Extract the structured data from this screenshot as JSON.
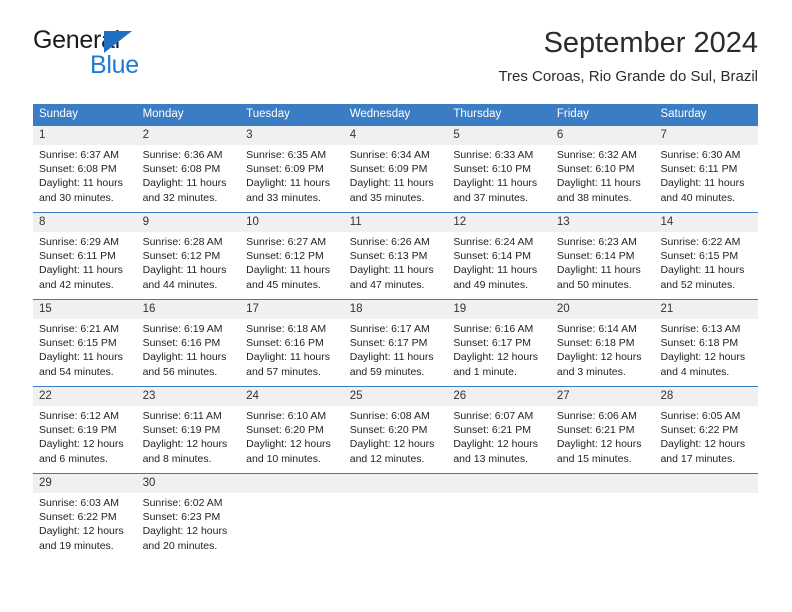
{
  "brand": {
    "line1": "General",
    "line2": "Blue",
    "triangle_color": "#1f6fc4",
    "blue_color": "#1f7ad4"
  },
  "header": {
    "title": "September 2024",
    "subtitle": "Tres Coroas, Rio Grande do Sul, Brazil"
  },
  "theme": {
    "header_blue": "#3b7dc4",
    "daynum_band": "#f0f0f0",
    "text": "#232323"
  },
  "weekdays": [
    "Sunday",
    "Monday",
    "Tuesday",
    "Wednesday",
    "Thursday",
    "Friday",
    "Saturday"
  ],
  "weeks": [
    {
      "numbers": [
        "1",
        "2",
        "3",
        "4",
        "5",
        "6",
        "7"
      ],
      "cells": [
        {
          "l1": "Sunrise: 6:37 AM",
          "l2": "Sunset: 6:08 PM",
          "l3": "Daylight: 11 hours",
          "l4": "and 30 minutes."
        },
        {
          "l1": "Sunrise: 6:36 AM",
          "l2": "Sunset: 6:08 PM",
          "l3": "Daylight: 11 hours",
          "l4": "and 32 minutes."
        },
        {
          "l1": "Sunrise: 6:35 AM",
          "l2": "Sunset: 6:09 PM",
          "l3": "Daylight: 11 hours",
          "l4": "and 33 minutes."
        },
        {
          "l1": "Sunrise: 6:34 AM",
          "l2": "Sunset: 6:09 PM",
          "l3": "Daylight: 11 hours",
          "l4": "and 35 minutes."
        },
        {
          "l1": "Sunrise: 6:33 AM",
          "l2": "Sunset: 6:10 PM",
          "l3": "Daylight: 11 hours",
          "l4": "and 37 minutes."
        },
        {
          "l1": "Sunrise: 6:32 AM",
          "l2": "Sunset: 6:10 PM",
          "l3": "Daylight: 11 hours",
          "l4": "and 38 minutes."
        },
        {
          "l1": "Sunrise: 6:30 AM",
          "l2": "Sunset: 6:11 PM",
          "l3": "Daylight: 11 hours",
          "l4": "and 40 minutes."
        }
      ]
    },
    {
      "numbers": [
        "8",
        "9",
        "10",
        "11",
        "12",
        "13",
        "14"
      ],
      "cells": [
        {
          "l1": "Sunrise: 6:29 AM",
          "l2": "Sunset: 6:11 PM",
          "l3": "Daylight: 11 hours",
          "l4": "and 42 minutes."
        },
        {
          "l1": "Sunrise: 6:28 AM",
          "l2": "Sunset: 6:12 PM",
          "l3": "Daylight: 11 hours",
          "l4": "and 44 minutes."
        },
        {
          "l1": "Sunrise: 6:27 AM",
          "l2": "Sunset: 6:12 PM",
          "l3": "Daylight: 11 hours",
          "l4": "and 45 minutes."
        },
        {
          "l1": "Sunrise: 6:26 AM",
          "l2": "Sunset: 6:13 PM",
          "l3": "Daylight: 11 hours",
          "l4": "and 47 minutes."
        },
        {
          "l1": "Sunrise: 6:24 AM",
          "l2": "Sunset: 6:14 PM",
          "l3": "Daylight: 11 hours",
          "l4": "and 49 minutes."
        },
        {
          "l1": "Sunrise: 6:23 AM",
          "l2": "Sunset: 6:14 PM",
          "l3": "Daylight: 11 hours",
          "l4": "and 50 minutes."
        },
        {
          "l1": "Sunrise: 6:22 AM",
          "l2": "Sunset: 6:15 PM",
          "l3": "Daylight: 11 hours",
          "l4": "and 52 minutes."
        }
      ]
    },
    {
      "numbers": [
        "15",
        "16",
        "17",
        "18",
        "19",
        "20",
        "21"
      ],
      "cells": [
        {
          "l1": "Sunrise: 6:21 AM",
          "l2": "Sunset: 6:15 PM",
          "l3": "Daylight: 11 hours",
          "l4": "and 54 minutes."
        },
        {
          "l1": "Sunrise: 6:19 AM",
          "l2": "Sunset: 6:16 PM",
          "l3": "Daylight: 11 hours",
          "l4": "and 56 minutes."
        },
        {
          "l1": "Sunrise: 6:18 AM",
          "l2": "Sunset: 6:16 PM",
          "l3": "Daylight: 11 hours",
          "l4": "and 57 minutes."
        },
        {
          "l1": "Sunrise: 6:17 AM",
          "l2": "Sunset: 6:17 PM",
          "l3": "Daylight: 11 hours",
          "l4": "and 59 minutes."
        },
        {
          "l1": "Sunrise: 6:16 AM",
          "l2": "Sunset: 6:17 PM",
          "l3": "Daylight: 12 hours",
          "l4": "and 1 minute."
        },
        {
          "l1": "Sunrise: 6:14 AM",
          "l2": "Sunset: 6:18 PM",
          "l3": "Daylight: 12 hours",
          "l4": "and 3 minutes."
        },
        {
          "l1": "Sunrise: 6:13 AM",
          "l2": "Sunset: 6:18 PM",
          "l3": "Daylight: 12 hours",
          "l4": "and 4 minutes."
        }
      ]
    },
    {
      "numbers": [
        "22",
        "23",
        "24",
        "25",
        "26",
        "27",
        "28"
      ],
      "cells": [
        {
          "l1": "Sunrise: 6:12 AM",
          "l2": "Sunset: 6:19 PM",
          "l3": "Daylight: 12 hours",
          "l4": "and 6 minutes."
        },
        {
          "l1": "Sunrise: 6:11 AM",
          "l2": "Sunset: 6:19 PM",
          "l3": "Daylight: 12 hours",
          "l4": "and 8 minutes."
        },
        {
          "l1": "Sunrise: 6:10 AM",
          "l2": "Sunset: 6:20 PM",
          "l3": "Daylight: 12 hours",
          "l4": "and 10 minutes."
        },
        {
          "l1": "Sunrise: 6:08 AM",
          "l2": "Sunset: 6:20 PM",
          "l3": "Daylight: 12 hours",
          "l4": "and 12 minutes."
        },
        {
          "l1": "Sunrise: 6:07 AM",
          "l2": "Sunset: 6:21 PM",
          "l3": "Daylight: 12 hours",
          "l4": "and 13 minutes."
        },
        {
          "l1": "Sunrise: 6:06 AM",
          "l2": "Sunset: 6:21 PM",
          "l3": "Daylight: 12 hours",
          "l4": "and 15 minutes."
        },
        {
          "l1": "Sunrise: 6:05 AM",
          "l2": "Sunset: 6:22 PM",
          "l3": "Daylight: 12 hours",
          "l4": "and 17 minutes."
        }
      ]
    },
    {
      "numbers": [
        "29",
        "30",
        "",
        "",
        "",
        "",
        ""
      ],
      "cells": [
        {
          "l1": "Sunrise: 6:03 AM",
          "l2": "Sunset: 6:22 PM",
          "l3": "Daylight: 12 hours",
          "l4": "and 19 minutes."
        },
        {
          "l1": "Sunrise: 6:02 AM",
          "l2": "Sunset: 6:23 PM",
          "l3": "Daylight: 12 hours",
          "l4": "and 20 minutes."
        },
        {
          "l1": "",
          "l2": "",
          "l3": "",
          "l4": ""
        },
        {
          "l1": "",
          "l2": "",
          "l3": "",
          "l4": ""
        },
        {
          "l1": "",
          "l2": "",
          "l3": "",
          "l4": ""
        },
        {
          "l1": "",
          "l2": "",
          "l3": "",
          "l4": ""
        },
        {
          "l1": "",
          "l2": "",
          "l3": "",
          "l4": ""
        }
      ]
    }
  ]
}
